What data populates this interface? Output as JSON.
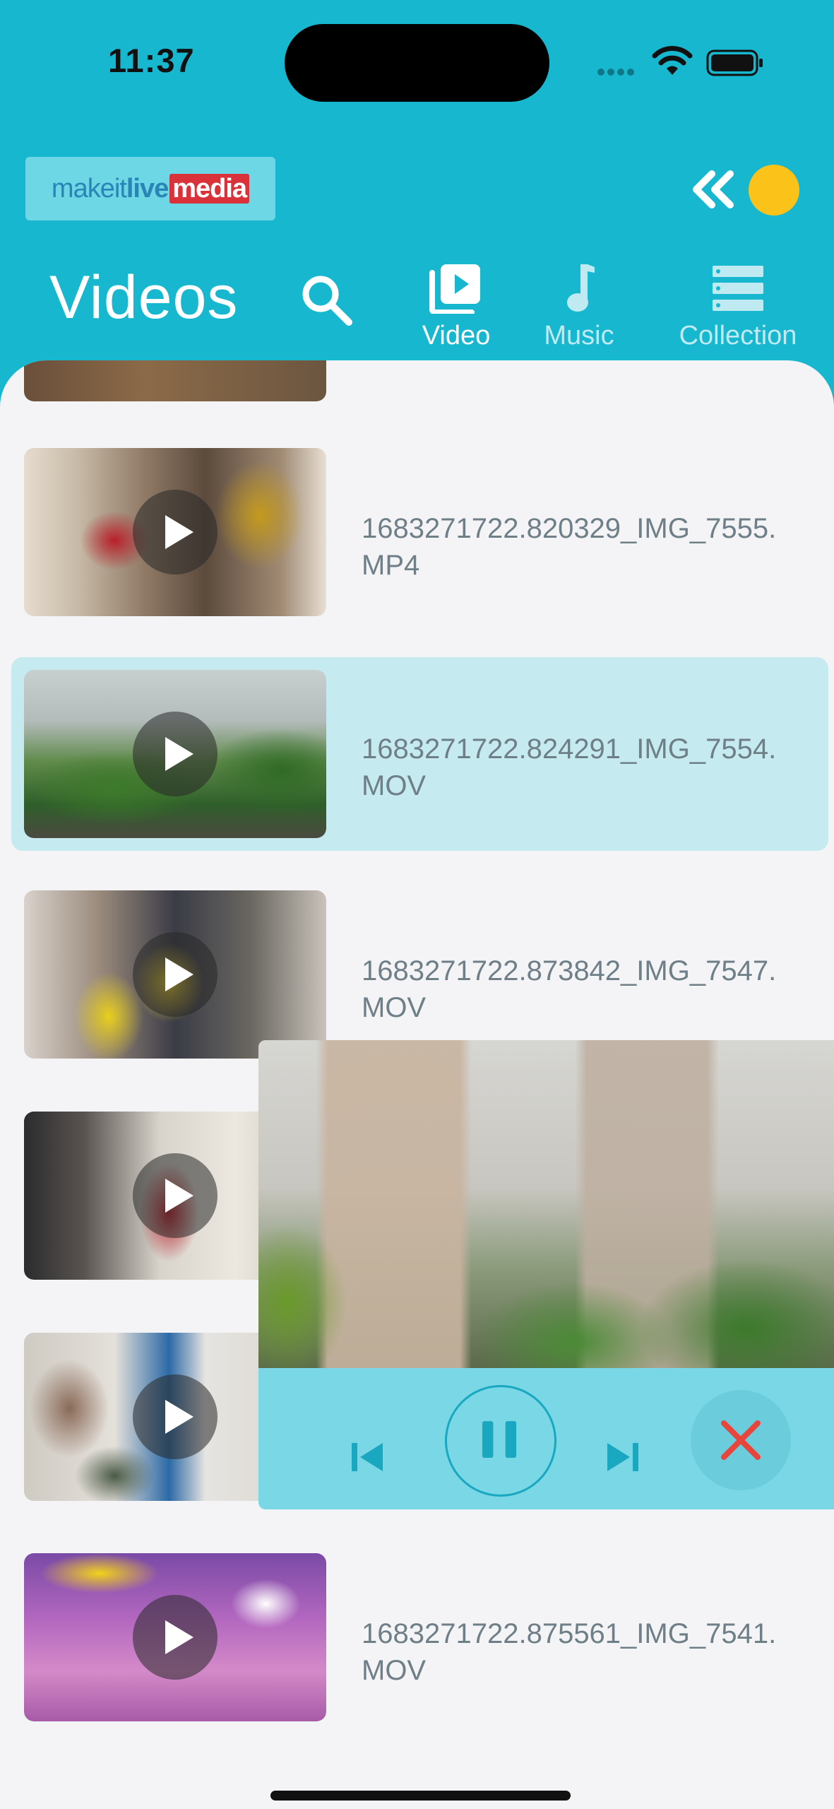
{
  "status_bar": {
    "time": "11:37"
  },
  "brand": {
    "part1": "makeit",
    "part2": "live",
    "part3": "media"
  },
  "header": {
    "title": "Videos"
  },
  "tabs": [
    {
      "label": "Video",
      "icon": "video-library-icon",
      "active": true
    },
    {
      "label": "Music",
      "icon": "music-note-icon",
      "active": false
    },
    {
      "label": "Collection",
      "icon": "collection-icon",
      "active": false
    }
  ],
  "videos": [
    {
      "title": "",
      "selected": false
    },
    {
      "title": "1683271722.820329_IMG_7555.MP4",
      "selected": false
    },
    {
      "title": "1683271722.824291_IMG_7554.MOV",
      "selected": true
    },
    {
      "title": "1683271722.873842_IMG_7547.MOV",
      "selected": false
    },
    {
      "title": "",
      "selected": false
    },
    {
      "title": "",
      "selected": false
    },
    {
      "title": "1683271722.875561_IMG_7541.MOV",
      "selected": false
    }
  ],
  "player": {
    "state": "playing"
  },
  "colors": {
    "header": "#17b8cf",
    "accent": "#fbc21a",
    "selected_row": "#c5eaef",
    "close": "#e8453c"
  }
}
